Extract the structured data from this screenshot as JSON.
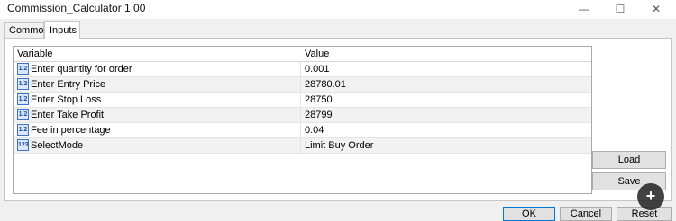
{
  "window": {
    "title": "Commission_Calculator 1.00",
    "minimize": "—",
    "maximize": "☐",
    "close": "✕"
  },
  "tabs": [
    {
      "label": "Common",
      "active": false
    },
    {
      "label": "Inputs",
      "active": true
    }
  ],
  "grid": {
    "headers": {
      "variable": "Variable",
      "value": "Value"
    },
    "rows": [
      {
        "icon": "1/2",
        "name": "Enter quantity for order",
        "value": "0.001"
      },
      {
        "icon": "1/2",
        "name": "Enter Entry Price",
        "value": "28780.01"
      },
      {
        "icon": "1/2",
        "name": "Enter Stop Loss",
        "value": "28750"
      },
      {
        "icon": "1/2",
        "name": "Enter Take Profit",
        "value": "28799"
      },
      {
        "icon": "1/2",
        "name": "Fee in percentage",
        "value": "0.04"
      },
      {
        "icon": "123",
        "name": "SelectMode",
        "value": "Limit Buy Order"
      }
    ]
  },
  "side_buttons": {
    "load": "Load",
    "save": "Save"
  },
  "footer_buttons": {
    "ok": "OK",
    "cancel": "Cancel",
    "reset": "Reset"
  },
  "zoom_icon": "+"
}
